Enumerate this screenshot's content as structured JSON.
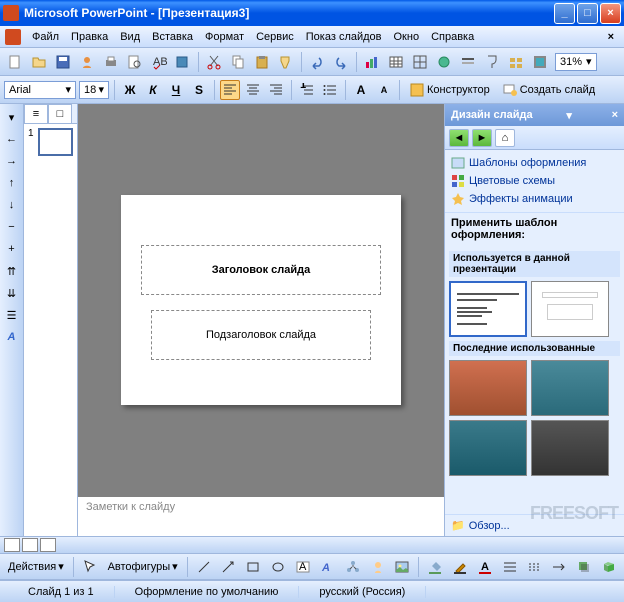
{
  "window": {
    "title": "Microsoft PowerPoint - [Презентация3]"
  },
  "menu": {
    "file": "Файл",
    "edit": "Правка",
    "view": "Вид",
    "insert": "Вставка",
    "format": "Формат",
    "tools": "Сервис",
    "slideshow": "Показ слайдов",
    "window": "Окно",
    "help": "Справка"
  },
  "toolbar": {
    "zoom": "31%"
  },
  "format": {
    "font": "Arial",
    "size": "18",
    "design": "Конструктор",
    "newslide": "Создать слайд"
  },
  "outline": {
    "slideNum": "1"
  },
  "slide": {
    "title": "Заголовок слайда",
    "subtitle": "Подзаголовок слайда"
  },
  "notes": {
    "placeholder": "Заметки к слайду"
  },
  "taskpane": {
    "title": "Дизайн слайда",
    "link1": "Шаблоны оформления",
    "link2": "Цветовые схемы",
    "link3": "Эффекты анимации",
    "applyLabel": "Применить шаблон оформления:",
    "group1": "Используется в данной презентации",
    "group2": "Последние использованные",
    "browse": "Обзор..."
  },
  "draw": {
    "actions": "Действия",
    "autoshapes": "Автофигуры"
  },
  "status": {
    "slide": "Слайд 1 из 1",
    "template": "Оформление по умолчанию",
    "lang": "русский (Россия)"
  },
  "watermark": "FREESOFT"
}
